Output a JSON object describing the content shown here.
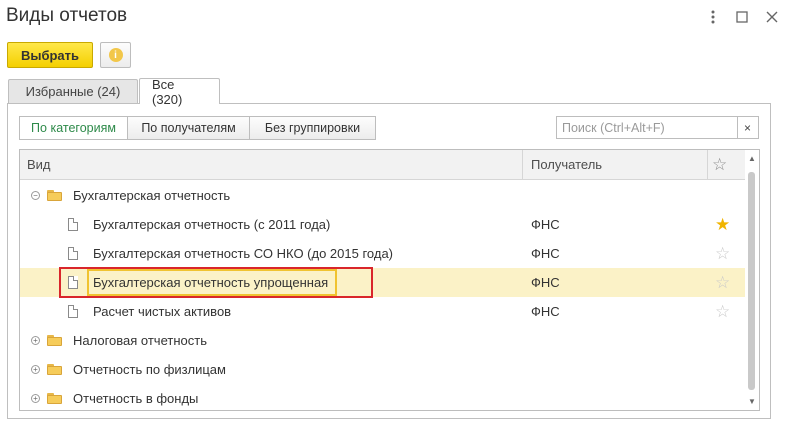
{
  "window": {
    "title": "Виды отчетов"
  },
  "toolbar": {
    "select_label": "Выбрать",
    "info_glyph": "i"
  },
  "tabs": [
    {
      "label": "Избранные (24)",
      "active": false
    },
    {
      "label": "Все (320)",
      "active": true
    }
  ],
  "grouping": {
    "options": [
      "По категориям",
      "По получателям",
      "Без группировки"
    ],
    "selected": "По категориям"
  },
  "search": {
    "placeholder": "Поиск (Ctrl+Alt+F)",
    "clear_glyph": "×"
  },
  "grid": {
    "columns": {
      "kind": "Вид",
      "recipient": "Получатель"
    },
    "rows": [
      {
        "type": "group",
        "label": "Бухгалтерская отчетность",
        "expanded": true,
        "toggle": "−"
      },
      {
        "type": "item",
        "label": "Бухгалтерская отчетность (с 2011 года)",
        "recipient": "ФНС",
        "favorite": true
      },
      {
        "type": "item",
        "label": "Бухгалтерская отчетность СО НКО (до 2015 года)",
        "recipient": "ФНС",
        "favorite": false
      },
      {
        "type": "item",
        "label": "Бухгалтерская отчетность упрощенная",
        "recipient": "ФНС",
        "favorite": false,
        "selected": true
      },
      {
        "type": "item",
        "label": "Расчет чистых активов",
        "recipient": "ФНС",
        "favorite": false
      },
      {
        "type": "group",
        "label": "Налоговая отчетность",
        "expanded": false,
        "toggle": "+"
      },
      {
        "type": "group",
        "label": "Отчетность по физлицам",
        "expanded": false,
        "toggle": "+"
      },
      {
        "type": "group",
        "label": "Отчетность в фонды",
        "expanded": false,
        "toggle": "+"
      }
    ]
  },
  "colors": {
    "primary_button": "#f4d000",
    "selection": "#fbf2c7",
    "highlight_frame": "#d9262b",
    "favorite_star": "#f0b400",
    "active_grouping": "#2e8a4a"
  }
}
